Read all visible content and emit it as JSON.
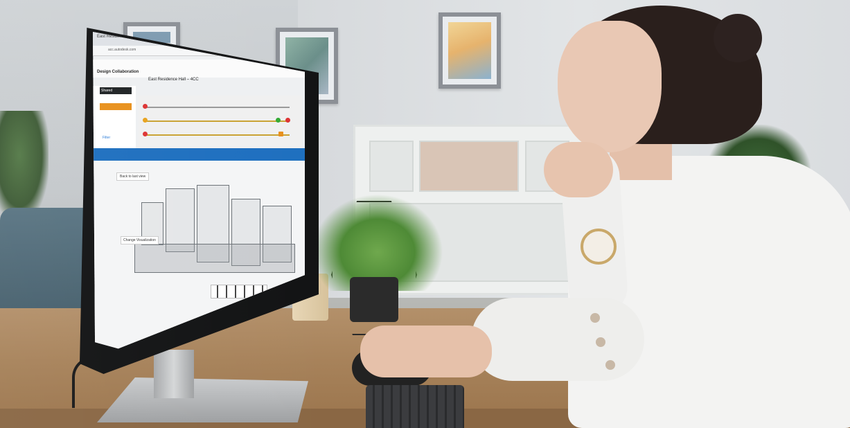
{
  "image": {
    "description_colors": {
      "wall": "#d6d9dc",
      "desk": "#a7825a",
      "sweater": "#f3f3f2",
      "accent_blue": "#1e6fbf",
      "accent_orange": "#e8901c"
    }
  },
  "screen": {
    "tab_title": "East Residence Hall – 4CC - Rev",
    "url": "acc.autodesk.com",
    "app_name": "Design Collaboration",
    "model_title": "East Residence Hall – 4CC",
    "sidebar": {
      "shared": "Shared",
      "filter": "Filter"
    },
    "viewer": {
      "back_button": "Back to last view",
      "change_visualization": "Change Visualization"
    }
  }
}
